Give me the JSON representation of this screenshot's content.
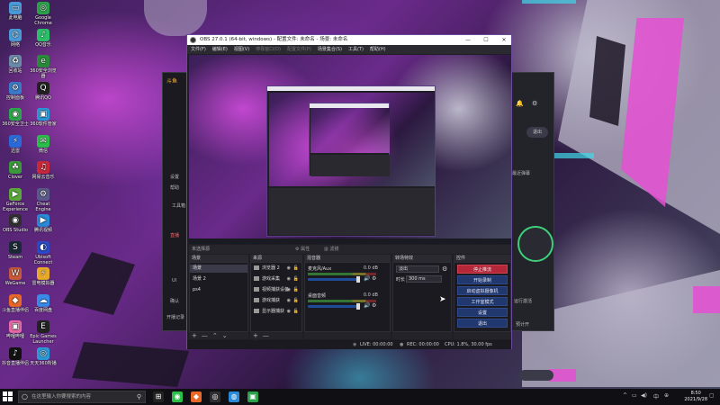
{
  "desktop": {
    "icons": [
      {
        "label": "此电脑",
        "glyph": "▭",
        "color": "#4a9ad8"
      },
      {
        "label": "Google Chrome",
        "glyph": "◎",
        "color": "#2ba24a"
      },
      {
        "label": "网络",
        "glyph": "⌬",
        "color": "#4a9ad8"
      },
      {
        "label": "QQ音乐",
        "glyph": "♪",
        "color": "#2bbf6a"
      },
      {
        "label": "回收站",
        "glyph": "♻",
        "color": "#6a8aa8"
      },
      {
        "label": "360安全浏览器",
        "glyph": "e",
        "color": "#2a8a3a"
      },
      {
        "label": "控制面板",
        "glyph": "⚙",
        "color": "#3a7ac8"
      },
      {
        "label": "腾讯QQ",
        "glyph": "Q",
        "color": "#222"
      },
      {
        "label": "360安全卫士",
        "glyph": "◉",
        "color": "#2aa84a"
      },
      {
        "label": "360软件管家",
        "glyph": "▣",
        "color": "#2a9ad8"
      },
      {
        "label": "迅雷",
        "glyph": "⚡",
        "color": "#2a6ad8"
      },
      {
        "label": "微信",
        "glyph": "✉",
        "color": "#2bbf4a"
      },
      {
        "label": "Clover",
        "glyph": "☘",
        "color": "#3a9a3a"
      },
      {
        "label": "网易云音乐",
        "glyph": "♫",
        "color": "#c8283a"
      },
      {
        "label": "GeForce Experience",
        "glyph": "▶",
        "color": "#5aa83a"
      },
      {
        "label": "Cheat Engine",
        "glyph": "⚙",
        "color": "#5a5a8a"
      },
      {
        "label": "OBS Studio",
        "glyph": "◉",
        "color": "#302e31"
      },
      {
        "label": "腾讯视频",
        "glyph": "▶",
        "color": "#2a8ad8"
      },
      {
        "label": "Steam",
        "glyph": "S",
        "color": "#1b2838"
      },
      {
        "label": "Ubisoft Connect",
        "glyph": "◐",
        "color": "#2a4ac8"
      },
      {
        "label": "WeGame",
        "glyph": "W",
        "color": "#c8583a"
      },
      {
        "label": "雷电模拟器",
        "glyph": "⚡",
        "color": "#e8a82a"
      },
      {
        "label": "斗鱼直播伴侣",
        "glyph": "◆",
        "color": "#e8682a"
      },
      {
        "label": "百度网盘",
        "glyph": "☁",
        "color": "#3a8ae8"
      },
      {
        "label": "哔哩哔哩",
        "glyph": "▣",
        "color": "#e86aa8"
      },
      {
        "label": "Epic Games Launcher",
        "glyph": "E",
        "color": "#222"
      },
      {
        "label": "抖音直播伴侣",
        "glyph": "♪",
        "color": "#111"
      },
      {
        "label": "天天360所播",
        "glyph": "◎",
        "color": "#2a9ad8"
      }
    ]
  },
  "bg_app": {
    "toolbox_label": "工具箱",
    "live_label": "直播",
    "exit_label": "退出",
    "ui_label": "UI",
    "ok_label": "确认",
    "log_label": "开播记录",
    "side_a": "设置",
    "side_b": "帮助",
    "right_a": "最近弹幕",
    "right_b": "运行激活",
    "right_c": "预计开",
    "brand_label": "斗鱼"
  },
  "obs": {
    "title": "OBS 27.0.1 (64-bit, windows) - 配置文件: 未命名 - 场景: 未命名",
    "menu": [
      {
        "label": "文件(F)",
        "dim": false
      },
      {
        "label": "编辑(E)",
        "dim": false
      },
      {
        "label": "视图(V)",
        "dim": false
      },
      {
        "label": "停靠窗口(D)",
        "dim": true
      },
      {
        "label": "配置文件(P)",
        "dim": true
      },
      {
        "label": "场景集合(S)",
        "dim": false
      },
      {
        "label": "工具(T)",
        "dim": false
      },
      {
        "label": "帮助(H)",
        "dim": false
      }
    ],
    "scene_toolbar": {
      "no_source": "未选择源",
      "properties": "属性",
      "filters": "滤镜"
    },
    "docks": {
      "scenes_title": "场景",
      "sources_title": "来源",
      "mixer_title": "混音器",
      "transitions_title": "转场特效",
      "controls_title": "控件"
    },
    "scenes": [
      {
        "name": "场景",
        "selected": true
      },
      {
        "name": "场景 2",
        "selected": false
      },
      {
        "name": "ps4",
        "selected": false
      }
    ],
    "sources": [
      {
        "name": "浏览器 2"
      },
      {
        "name": "游戏采集"
      },
      {
        "name": "视频捕获设备"
      },
      {
        "name": "游戏捕获"
      },
      {
        "name": "显示器捕获"
      }
    ],
    "mixer": [
      {
        "name": "麦克风/Aux",
        "db": "0.0 dB"
      },
      {
        "name": "桌面音频",
        "db": "0.0 dB"
      }
    ],
    "transitions": {
      "type": "淡出",
      "duration_label": "时长",
      "duration_value": "300 ms"
    },
    "controls": [
      {
        "label": "停止推流",
        "active": true
      },
      {
        "label": "开始录制",
        "active": false
      },
      {
        "label": "启动虚拟摄像机",
        "active": false
      },
      {
        "label": "工作室模式",
        "active": false
      },
      {
        "label": "设置",
        "active": false
      },
      {
        "label": "退出",
        "active": false
      }
    ],
    "status": {
      "live": "LIVE: 00:00:00",
      "rec": "REC: 00:00:00",
      "cpu": "CPU: 1.8%, 30.00 fps"
    },
    "accent_colors": {
      "active_button": "#b5283a",
      "button": "#20386e",
      "slider": "#1e4c9a"
    }
  },
  "taskbar": {
    "search_placeholder": "在这里输入你要搜索的内容",
    "time": "8:50",
    "date": "2021/9/28",
    "apps": [
      {
        "glyph": "⊞",
        "color": "#222"
      },
      {
        "glyph": "◉",
        "color": "#2bbf4a"
      },
      {
        "glyph": "◆",
        "color": "#e8682a"
      },
      {
        "glyph": "◎",
        "color": "#302e31"
      },
      {
        "glyph": "◍",
        "color": "#2a8ad8"
      },
      {
        "glyph": "▣",
        "color": "#2ba24a"
      }
    ]
  }
}
